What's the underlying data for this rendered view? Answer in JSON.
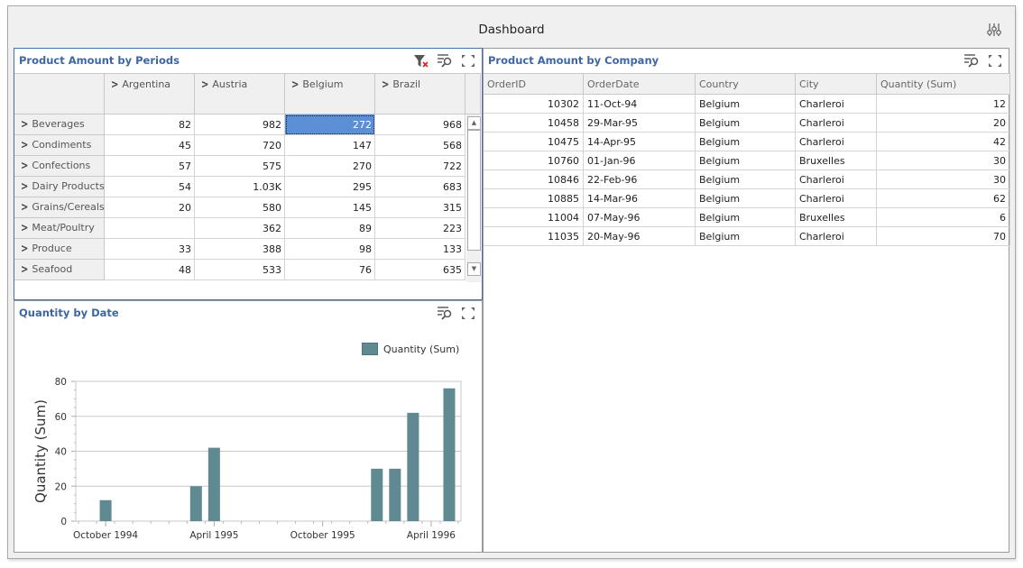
{
  "dashboard": {
    "title": "Dashboard",
    "params_icon": "parameters-icon"
  },
  "pivot": {
    "caption": "Product Amount by Periods",
    "tools": [
      "clear-filter-icon",
      "multi-select-icon",
      "maximize-icon"
    ],
    "columns": [
      "Argentina",
      "Austria",
      "Belgium",
      "Brazil"
    ],
    "rows": [
      {
        "label": "Beverages",
        "values": [
          "82",
          "982",
          "272",
          "968"
        ]
      },
      {
        "label": "Condiments",
        "values": [
          "45",
          "720",
          "147",
          "568"
        ]
      },
      {
        "label": "Confections",
        "values": [
          "57",
          "575",
          "270",
          "722"
        ]
      },
      {
        "label": "Dairy Products",
        "values": [
          "54",
          "1.03K",
          "295",
          "683"
        ]
      },
      {
        "label": "Grains/Cereals",
        "values": [
          "20",
          "580",
          "145",
          "315"
        ]
      },
      {
        "label": "Meat/Poultry",
        "values": [
          "",
          "362",
          "89",
          "223"
        ]
      },
      {
        "label": "Produce",
        "values": [
          "33",
          "388",
          "98",
          "133"
        ]
      },
      {
        "label": "Seafood",
        "values": [
          "48",
          "533",
          "76",
          "635"
        ]
      }
    ],
    "selected_cell": {
      "row": 0,
      "col": 2
    }
  },
  "grid": {
    "caption": "Product Amount by Company",
    "tools": [
      "multi-select-icon",
      "maximize-icon"
    ],
    "columns": [
      "OrderID",
      "OrderDate",
      "Country",
      "City",
      "Quantity (Sum)"
    ],
    "rows": [
      [
        "10302",
        "11-Oct-94",
        "Belgium",
        "Charleroi",
        "12"
      ],
      [
        "10458",
        "29-Mar-95",
        "Belgium",
        "Charleroi",
        "20"
      ],
      [
        "10475",
        "14-Apr-95",
        "Belgium",
        "Charleroi",
        "42"
      ],
      [
        "10760",
        "01-Jan-96",
        "Belgium",
        "Bruxelles",
        "30"
      ],
      [
        "10846",
        "22-Feb-96",
        "Belgium",
        "Charleroi",
        "30"
      ],
      [
        "10885",
        "14-Mar-96",
        "Belgium",
        "Charleroi",
        "62"
      ],
      [
        "11004",
        "07-May-96",
        "Belgium",
        "Bruxelles",
        "6"
      ],
      [
        "11035",
        "20-May-96",
        "Belgium",
        "Charleroi",
        "70"
      ]
    ]
  },
  "chart": {
    "caption": "Quantity by Date",
    "tools": [
      "multi-select-icon",
      "maximize-icon"
    ]
  },
  "chart_data": {
    "type": "bar",
    "title": "Quantity by Date",
    "xlabel": "",
    "ylabel": "Quantity (Sum)",
    "ylim": [
      0,
      80
    ],
    "yticks": [
      0,
      20,
      40,
      60,
      80
    ],
    "grid": true,
    "legend": "top-right",
    "bar_color": "#5f8a92",
    "x_months_start": "1994-09",
    "x_months_count": 21,
    "xtick_labels": [
      {
        "month_index": 1,
        "label": "October 1994"
      },
      {
        "month_index": 7,
        "label": "April 1995"
      },
      {
        "month_index": 13,
        "label": "October 1995"
      },
      {
        "month_index": 19,
        "label": "April 1996"
      }
    ],
    "series": [
      {
        "name": "Quantity (Sum)",
        "points": [
          {
            "month_index": 1,
            "x": "1994-10",
            "value": 12
          },
          {
            "month_index": 6,
            "x": "1995-03",
            "value": 20
          },
          {
            "month_index": 7,
            "x": "1995-04",
            "value": 42
          },
          {
            "month_index": 16,
            "x": "1996-01",
            "value": 30
          },
          {
            "month_index": 17,
            "x": "1996-02",
            "value": 30
          },
          {
            "month_index": 18,
            "x": "1996-03",
            "value": 62
          },
          {
            "month_index": 20,
            "x": "1996-05",
            "value": 76
          }
        ]
      }
    ]
  }
}
